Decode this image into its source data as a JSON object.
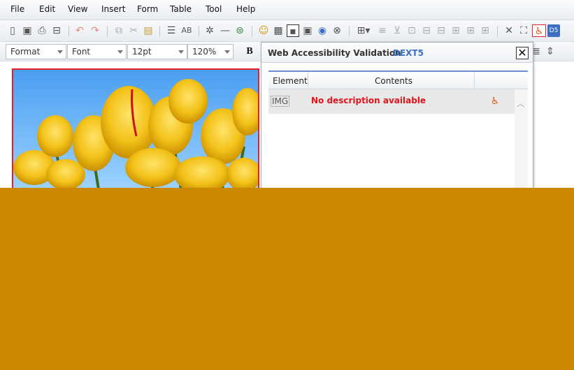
{
  "menu": [
    "File",
    "Edit",
    "View",
    "Insert",
    "Form",
    "Table",
    "Tool",
    "Help"
  ],
  "toolbar": {
    "icons": [
      "new-document-icon",
      "save-icon",
      "print-icon",
      "print-preview-icon",
      "undo-icon",
      "redo-icon",
      "copy-icon",
      "cut-icon",
      "paste-icon",
      "source-icon",
      "spellcheck-icon",
      "special-char-icon",
      "horizontal-rule-icon",
      "link-icon",
      "emoticon-icon",
      "pattern-icon",
      "image-icon",
      "media-icon",
      "chart-icon",
      "flash-icon",
      "table-icon",
      "table-props-icon",
      "cell-props-icon",
      "split-cell-icon",
      "row-above-icon",
      "row-below-icon",
      "col-left-icon",
      "col-right-icon",
      "merge-icon",
      "tools-icon",
      "fullscreen-icon",
      "accessibility-icon",
      "dext-icon"
    ]
  },
  "format_bar": {
    "format": "Format",
    "font": "Font",
    "size": "12pt",
    "zoom": "120%",
    "bold": "B"
  },
  "panel": {
    "title": "Web Accessibility Validation",
    "brand": "DEXT5",
    "close": "✕",
    "columns": [
      "Element",
      "Contents"
    ],
    "rows": [
      {
        "element": "IMG",
        "message": "No description available"
      }
    ]
  },
  "colors": {
    "accent": "#3b6fc4",
    "error": "#e0151b",
    "selection": "#e0202a",
    "background": "#CC8800"
  }
}
